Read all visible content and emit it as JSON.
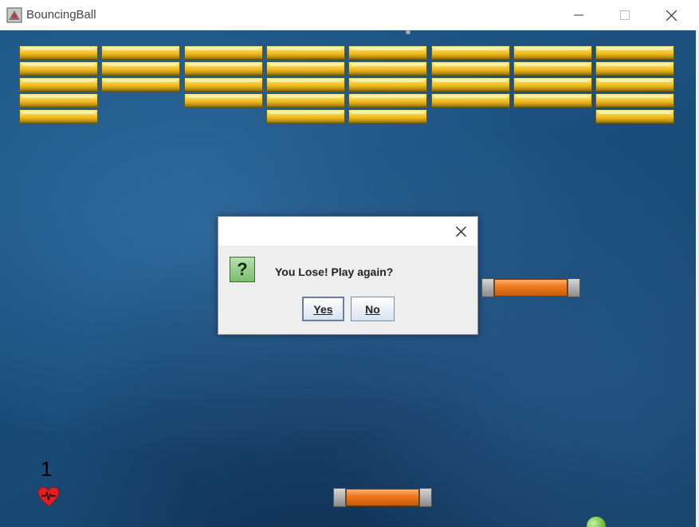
{
  "window": {
    "title": "BouncingBall"
  },
  "game": {
    "lives": "1",
    "bricks_per_column": [
      5,
      3,
      4,
      5,
      5,
      4,
      4,
      5
    ]
  },
  "dialog": {
    "message": "You Lose! Play again?",
    "yes_label": "Yes",
    "no_label": "No"
  },
  "colors": {
    "brick": "#f0c020",
    "paddle": "#f07a20",
    "ball": "#6cba3a",
    "background": "#1a4d7a"
  }
}
